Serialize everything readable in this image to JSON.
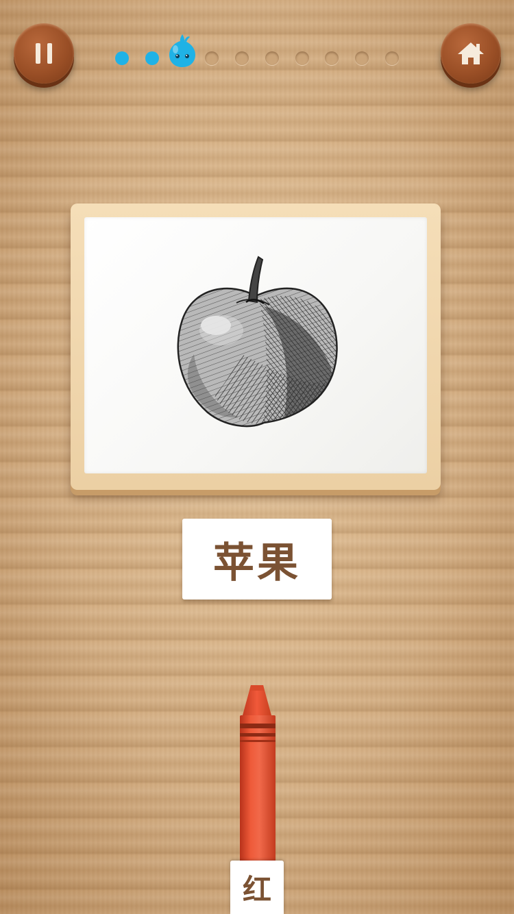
{
  "toolbar": {
    "pause_icon": "pause-icon",
    "home_icon": "home-icon"
  },
  "progress": {
    "total_steps": 10,
    "completed_steps": 2,
    "current_step": 3,
    "active_color": "#1fb2e6"
  },
  "card": {
    "picture": "apple-sketch"
  },
  "word": {
    "text": "苹果"
  },
  "crayon": {
    "color": "#e34a2a",
    "label": "红"
  }
}
